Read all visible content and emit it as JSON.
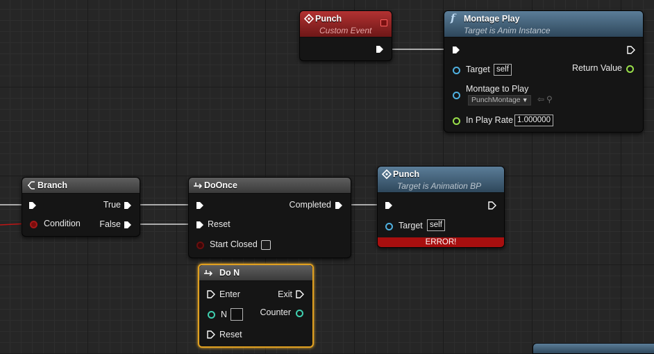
{
  "nodes": {
    "punch_event": {
      "title": "Punch",
      "subtitle": "Custom Event"
    },
    "montage_play": {
      "title": "Montage Play",
      "subtitle": "Target is Anim Instance",
      "target_label": "Target",
      "target_value": "self",
      "return_label": "Return Value",
      "montage_label": "Montage to Play",
      "montage_value": "PunchMontage",
      "rate_label": "In Play Rate",
      "rate_value": "1.000000"
    },
    "branch": {
      "title": "Branch",
      "true_label": "True",
      "false_label": "False",
      "condition_label": "Condition"
    },
    "do_once": {
      "title": "DoOnce",
      "completed_label": "Completed",
      "reset_label": "Reset",
      "start_closed_label": "Start Closed"
    },
    "punch_call": {
      "title": "Punch",
      "subtitle": "Target is Animation BP",
      "target_label": "Target",
      "target_value": "self",
      "error_text": "ERROR!"
    },
    "do_n": {
      "title": "Do N",
      "enter_label": "Enter",
      "exit_label": "Exit",
      "n_label": "N",
      "counter_label": "Counter",
      "reset_label": "Reset"
    }
  },
  "colors": {
    "exec": "#ffffff",
    "object_pin": "#4fb0e0",
    "float_pin": "#9ae04a",
    "int_pin": "#3fd0b0",
    "bool_pin": "#a51818",
    "error": "#a80f0f",
    "selection": "#e0a020"
  },
  "icons": {
    "event": "event-diamond-icon",
    "function": "function-f-icon",
    "branch": "branch-icon",
    "flow": "flow-control-icon",
    "dispatch": "delegate-pin-icon"
  }
}
